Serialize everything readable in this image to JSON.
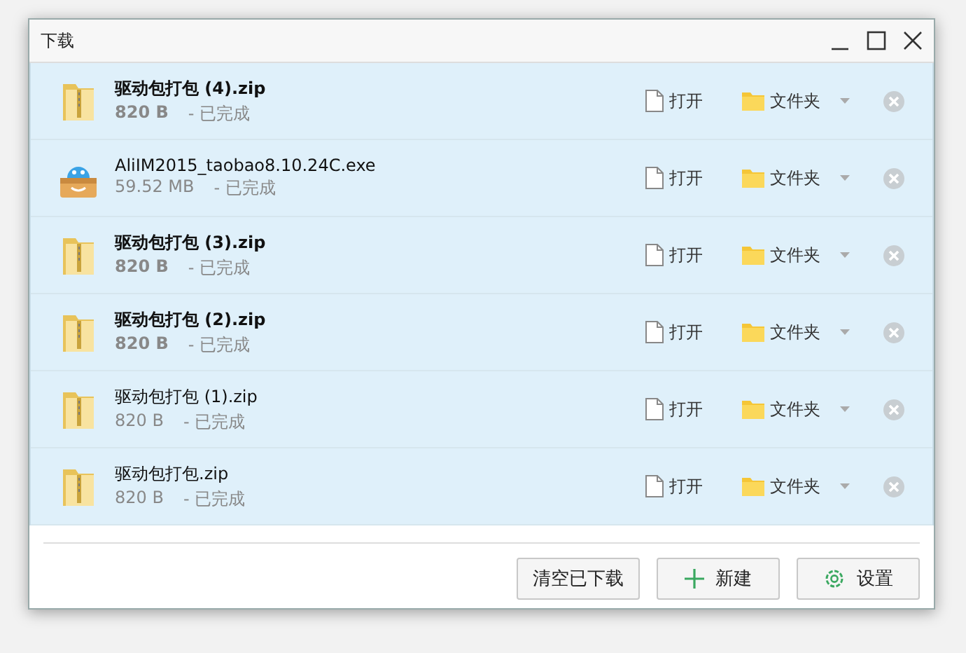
{
  "window": {
    "title": "下载"
  },
  "downloads": [
    {
      "kind": "zip",
      "name": "驱动包打包 (4).zip",
      "size": "820 B",
      "status": "- 已完成",
      "bold": true,
      "open": "打开",
      "folder": "文件夹"
    },
    {
      "kind": "exe",
      "name": "AliIM2015_taobao8.10.24C.exe",
      "size": "59.52 MB",
      "status": "- 已完成",
      "bold": false,
      "open": "打开",
      "folder": "文件夹"
    },
    {
      "kind": "zip",
      "name": "驱动包打包 (3).zip",
      "size": "820 B",
      "status": "- 已完成",
      "bold": true,
      "open": "打开",
      "folder": "文件夹"
    },
    {
      "kind": "zip",
      "name": "驱动包打包 (2).zip",
      "size": "820 B",
      "status": "- 已完成",
      "bold": true,
      "open": "打开",
      "folder": "文件夹"
    },
    {
      "kind": "zip",
      "name": "驱动包打包 (1).zip",
      "size": "820 B",
      "status": "- 已完成",
      "bold": false,
      "open": "打开",
      "folder": "文件夹"
    },
    {
      "kind": "zip",
      "name": "驱动包打包.zip",
      "size": "820 B",
      "status": "- 已完成",
      "bold": false,
      "open": "打开",
      "folder": "文件夹"
    }
  ],
  "buttons": [
    {
      "kind": "clear",
      "label": "清空已下载"
    },
    {
      "kind": "new",
      "label": "新建"
    },
    {
      "kind": "settings",
      "label": "设置"
    }
  ]
}
